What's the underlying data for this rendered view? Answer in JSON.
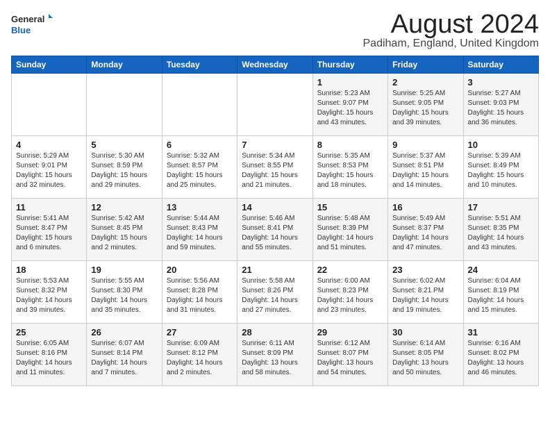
{
  "header": {
    "logo_line1": "General",
    "logo_line2": "Blue",
    "month": "August 2024",
    "location": "Padiham, England, United Kingdom"
  },
  "weekdays": [
    "Sunday",
    "Monday",
    "Tuesday",
    "Wednesday",
    "Thursday",
    "Friday",
    "Saturday"
  ],
  "weeks": [
    [
      {
        "day": "",
        "info": ""
      },
      {
        "day": "",
        "info": ""
      },
      {
        "day": "",
        "info": ""
      },
      {
        "day": "",
        "info": ""
      },
      {
        "day": "1",
        "info": "Sunrise: 5:23 AM\nSunset: 9:07 PM\nDaylight: 15 hours\nand 43 minutes."
      },
      {
        "day": "2",
        "info": "Sunrise: 5:25 AM\nSunset: 9:05 PM\nDaylight: 15 hours\nand 39 minutes."
      },
      {
        "day": "3",
        "info": "Sunrise: 5:27 AM\nSunset: 9:03 PM\nDaylight: 15 hours\nand 36 minutes."
      }
    ],
    [
      {
        "day": "4",
        "info": "Sunrise: 5:29 AM\nSunset: 9:01 PM\nDaylight: 15 hours\nand 32 minutes."
      },
      {
        "day": "5",
        "info": "Sunrise: 5:30 AM\nSunset: 8:59 PM\nDaylight: 15 hours\nand 29 minutes."
      },
      {
        "day": "6",
        "info": "Sunrise: 5:32 AM\nSunset: 8:57 PM\nDaylight: 15 hours\nand 25 minutes."
      },
      {
        "day": "7",
        "info": "Sunrise: 5:34 AM\nSunset: 8:55 PM\nDaylight: 15 hours\nand 21 minutes."
      },
      {
        "day": "8",
        "info": "Sunrise: 5:35 AM\nSunset: 8:53 PM\nDaylight: 15 hours\nand 18 minutes."
      },
      {
        "day": "9",
        "info": "Sunrise: 5:37 AM\nSunset: 8:51 PM\nDaylight: 15 hours\nand 14 minutes."
      },
      {
        "day": "10",
        "info": "Sunrise: 5:39 AM\nSunset: 8:49 PM\nDaylight: 15 hours\nand 10 minutes."
      }
    ],
    [
      {
        "day": "11",
        "info": "Sunrise: 5:41 AM\nSunset: 8:47 PM\nDaylight: 15 hours\nand 6 minutes."
      },
      {
        "day": "12",
        "info": "Sunrise: 5:42 AM\nSunset: 8:45 PM\nDaylight: 15 hours\nand 2 minutes."
      },
      {
        "day": "13",
        "info": "Sunrise: 5:44 AM\nSunset: 8:43 PM\nDaylight: 14 hours\nand 59 minutes."
      },
      {
        "day": "14",
        "info": "Sunrise: 5:46 AM\nSunset: 8:41 PM\nDaylight: 14 hours\nand 55 minutes."
      },
      {
        "day": "15",
        "info": "Sunrise: 5:48 AM\nSunset: 8:39 PM\nDaylight: 14 hours\nand 51 minutes."
      },
      {
        "day": "16",
        "info": "Sunrise: 5:49 AM\nSunset: 8:37 PM\nDaylight: 14 hours\nand 47 minutes."
      },
      {
        "day": "17",
        "info": "Sunrise: 5:51 AM\nSunset: 8:35 PM\nDaylight: 14 hours\nand 43 minutes."
      }
    ],
    [
      {
        "day": "18",
        "info": "Sunrise: 5:53 AM\nSunset: 8:32 PM\nDaylight: 14 hours\nand 39 minutes."
      },
      {
        "day": "19",
        "info": "Sunrise: 5:55 AM\nSunset: 8:30 PM\nDaylight: 14 hours\nand 35 minutes."
      },
      {
        "day": "20",
        "info": "Sunrise: 5:56 AM\nSunset: 8:28 PM\nDaylight: 14 hours\nand 31 minutes."
      },
      {
        "day": "21",
        "info": "Sunrise: 5:58 AM\nSunset: 8:26 PM\nDaylight: 14 hours\nand 27 minutes."
      },
      {
        "day": "22",
        "info": "Sunrise: 6:00 AM\nSunset: 8:23 PM\nDaylight: 14 hours\nand 23 minutes."
      },
      {
        "day": "23",
        "info": "Sunrise: 6:02 AM\nSunset: 8:21 PM\nDaylight: 14 hours\nand 19 minutes."
      },
      {
        "day": "24",
        "info": "Sunrise: 6:04 AM\nSunset: 8:19 PM\nDaylight: 14 hours\nand 15 minutes."
      }
    ],
    [
      {
        "day": "25",
        "info": "Sunrise: 6:05 AM\nSunset: 8:16 PM\nDaylight: 14 hours\nand 11 minutes."
      },
      {
        "day": "26",
        "info": "Sunrise: 6:07 AM\nSunset: 8:14 PM\nDaylight: 14 hours\nand 7 minutes."
      },
      {
        "day": "27",
        "info": "Sunrise: 6:09 AM\nSunset: 8:12 PM\nDaylight: 14 hours\nand 2 minutes."
      },
      {
        "day": "28",
        "info": "Sunrise: 6:11 AM\nSunset: 8:09 PM\nDaylight: 13 hours\nand 58 minutes."
      },
      {
        "day": "29",
        "info": "Sunrise: 6:12 AM\nSunset: 8:07 PM\nDaylight: 13 hours\nand 54 minutes."
      },
      {
        "day": "30",
        "info": "Sunrise: 6:14 AM\nSunset: 8:05 PM\nDaylight: 13 hours\nand 50 minutes."
      },
      {
        "day": "31",
        "info": "Sunrise: 6:16 AM\nSunset: 8:02 PM\nDaylight: 13 hours\nand 46 minutes."
      }
    ]
  ]
}
